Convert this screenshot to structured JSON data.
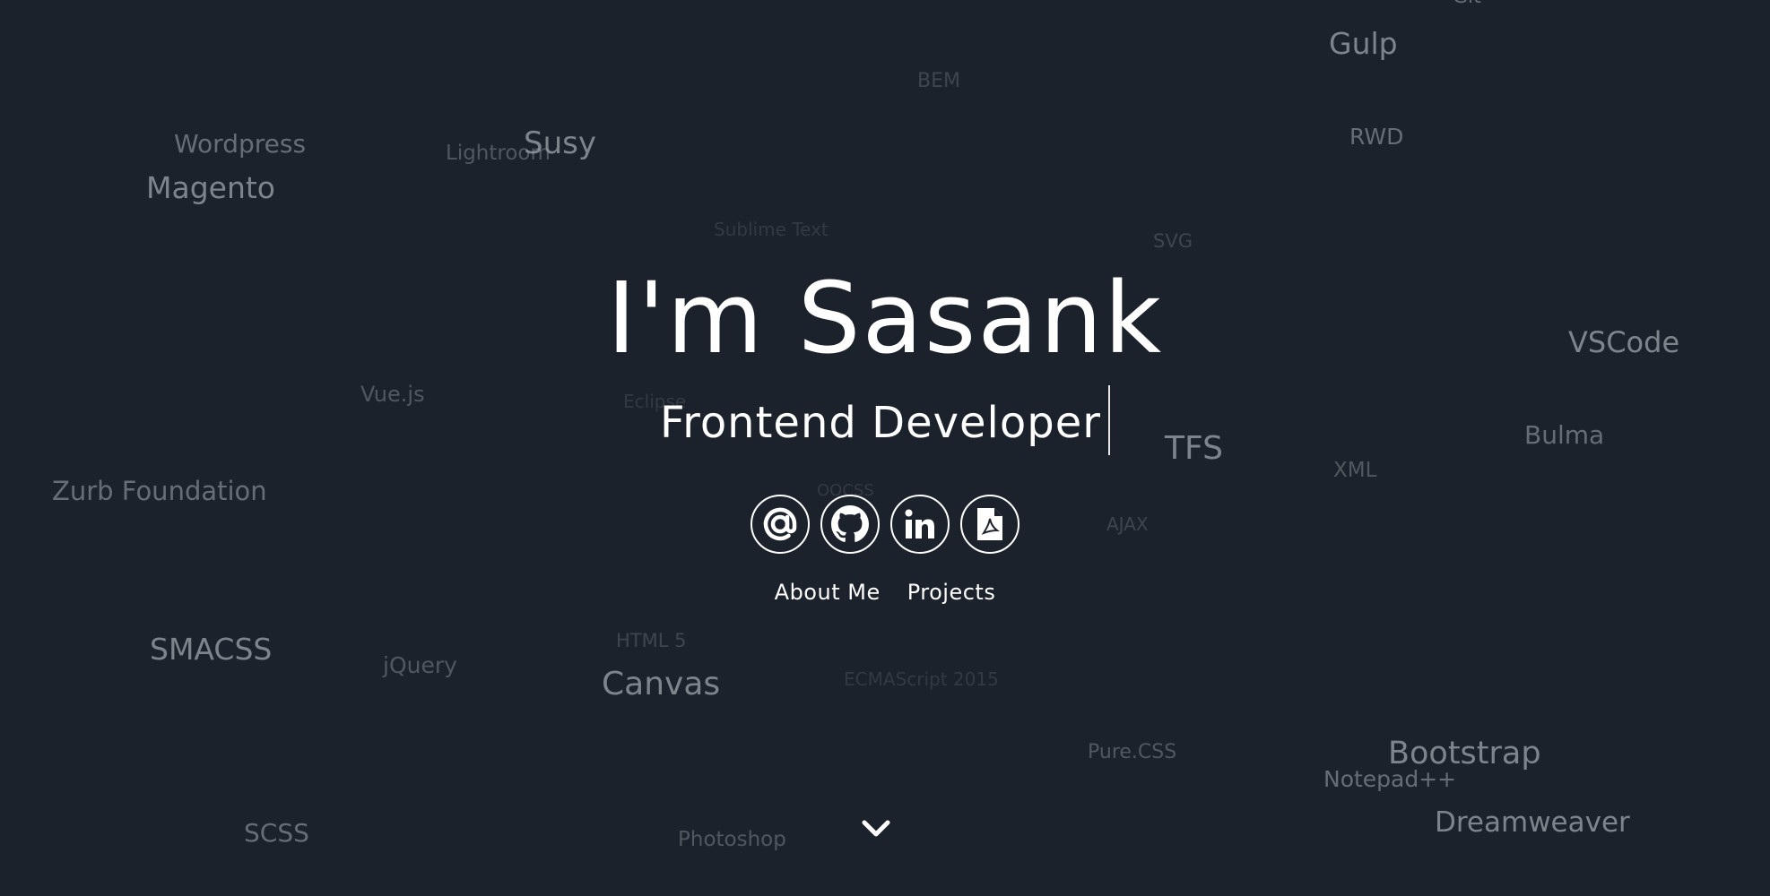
{
  "hero": {
    "title": "I'm Sasank",
    "subtitle": "Frontend Developer"
  },
  "social": [
    {
      "name": "email",
      "icon": "at-sign-icon"
    },
    {
      "name": "github",
      "icon": "github-icon"
    },
    {
      "name": "linkedin",
      "icon": "linkedin-icon"
    },
    {
      "name": "resume",
      "icon": "pdf-file-icon"
    }
  ],
  "nav": {
    "about_label": "About Me",
    "projects_label": "Projects"
  },
  "scroll": {
    "icon": "chevron-down-icon"
  },
  "colors": {
    "background": "#1c222b",
    "text": "#ffffff",
    "tag_text": "#9aa0a8"
  },
  "tags": [
    "Gulp",
    "BEM",
    "RWD",
    "Wordpress",
    "Lightroom",
    "Susy",
    "Magento",
    "Sublime Text",
    "SVG",
    "VSCode",
    "Vue.js",
    "Eclipse",
    "TFS",
    "Bulma",
    "XML",
    "Zurb Foundation",
    "OOCSS",
    "AJAX",
    "SMACSS",
    "jQuery",
    "HTML 5",
    "Canvas",
    "ECMAScript 2015",
    "Pure.CSS",
    "Bootstrap",
    "Notepad++",
    "Dreamweaver",
    "SCSS",
    "Photoshop",
    "Git"
  ]
}
